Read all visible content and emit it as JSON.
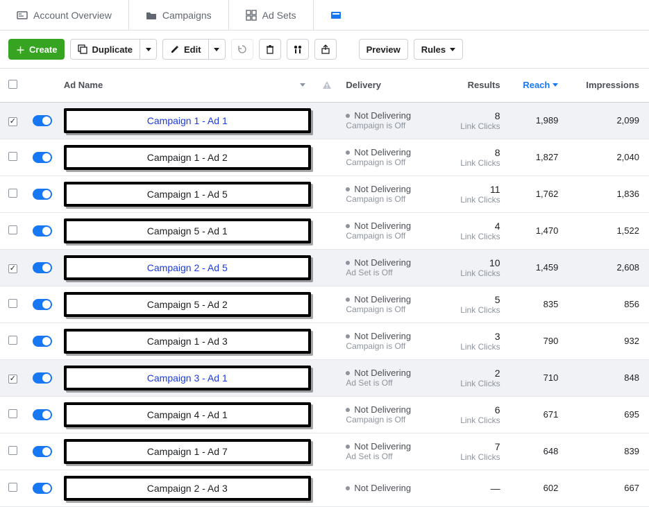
{
  "tabs": {
    "overview": "Account Overview",
    "campaigns": "Campaigns",
    "adsets": "Ad Sets"
  },
  "toolbar": {
    "create": "Create",
    "duplicate": "Duplicate",
    "edit": "Edit",
    "preview": "Preview",
    "rules": "Rules"
  },
  "columns": {
    "name": "Ad Name",
    "delivery": "Delivery",
    "results": "Results",
    "reach": "Reach",
    "impressions": "Impressions"
  },
  "rows": [
    {
      "checked": true,
      "name": "Campaign 1 - Ad 1",
      "link": true,
      "delivery": "Not Delivering",
      "delivery_sub": "Campaign is Off",
      "results": "8",
      "results_sub": "Link Clicks",
      "reach": "1,989",
      "impr": "2,099"
    },
    {
      "checked": false,
      "name": "Campaign 1 - Ad 2",
      "link": false,
      "delivery": "Not Delivering",
      "delivery_sub": "Campaign is Off",
      "results": "8",
      "results_sub": "Link Clicks",
      "reach": "1,827",
      "impr": "2,040"
    },
    {
      "checked": false,
      "name": "Campaign 1 - Ad 5",
      "link": false,
      "delivery": "Not Delivering",
      "delivery_sub": "Campaign is Off",
      "results": "11",
      "results_sub": "Link Clicks",
      "reach": "1,762",
      "impr": "1,836"
    },
    {
      "checked": false,
      "name": "Campaign 5 - Ad 1",
      "link": false,
      "delivery": "Not Delivering",
      "delivery_sub": "Campaign is Off",
      "results": "4",
      "results_sub": "Link Clicks",
      "reach": "1,470",
      "impr": "1,522"
    },
    {
      "checked": true,
      "name": "Campaign 2 - Ad 5",
      "link": true,
      "delivery": "Not Delivering",
      "delivery_sub": "Ad Set is Off",
      "results": "10",
      "results_sub": "Link Clicks",
      "reach": "1,459",
      "impr": "2,608"
    },
    {
      "checked": false,
      "name": "Campaign 5 - Ad 2",
      "link": false,
      "delivery": "Not Delivering",
      "delivery_sub": "Campaign is Off",
      "results": "5",
      "results_sub": "Link Clicks",
      "reach": "835",
      "impr": "856"
    },
    {
      "checked": false,
      "name": "Campaign 1 - Ad 3",
      "link": false,
      "delivery": "Not Delivering",
      "delivery_sub": "Campaign is Off",
      "results": "3",
      "results_sub": "Link Clicks",
      "reach": "790",
      "impr": "932"
    },
    {
      "checked": true,
      "name": "Campaign 3 - Ad 1",
      "link": true,
      "delivery": "Not Delivering",
      "delivery_sub": "Ad Set is Off",
      "results": "2",
      "results_sub": "Link Clicks",
      "reach": "710",
      "impr": "848"
    },
    {
      "checked": false,
      "name": "Campaign 4 - Ad 1",
      "link": false,
      "delivery": "Not Delivering",
      "delivery_sub": "Campaign is Off",
      "results": "6",
      "results_sub": "Link Clicks",
      "reach": "671",
      "impr": "695"
    },
    {
      "checked": false,
      "name": "Campaign 1 - Ad 7",
      "link": false,
      "delivery": "Not Delivering",
      "delivery_sub": "Ad Set is Off",
      "results": "7",
      "results_sub": "Link Clicks",
      "reach": "648",
      "impr": "839"
    },
    {
      "checked": false,
      "name": "Campaign 2 - Ad 3",
      "link": false,
      "delivery": "Not Delivering",
      "delivery_sub": "",
      "results": "—",
      "results_sub": "",
      "reach": "602",
      "impr": "667"
    }
  ]
}
